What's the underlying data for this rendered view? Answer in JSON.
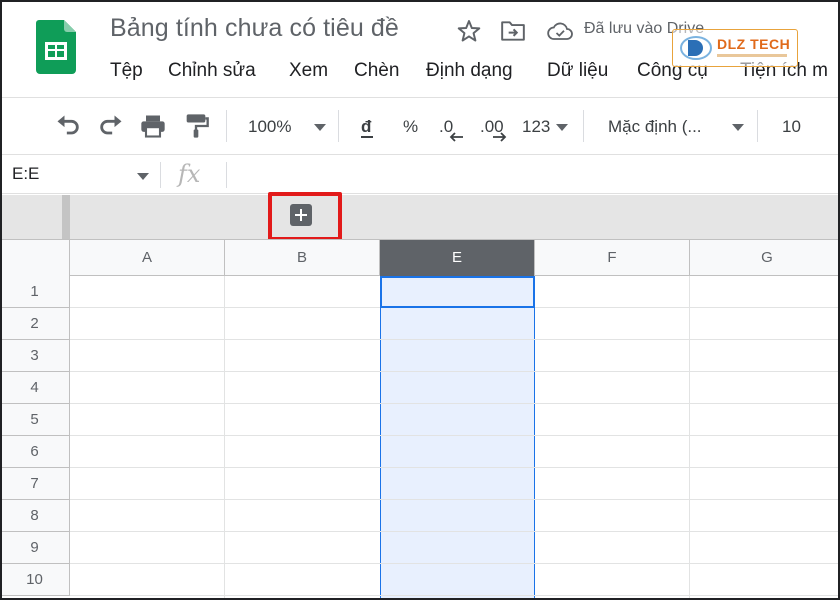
{
  "header": {
    "title": "Bảng tính chưa có tiêu đề",
    "save_status": "Đã lưu vào Drive",
    "watermark": "DLZ TECH"
  },
  "menu": [
    "Tệp",
    "Chỉnh sửa",
    "Xem",
    "Chèn",
    "Định dạng",
    "Dữ liệu",
    "Công cụ",
    "Tiện ích m"
  ],
  "toolbar": {
    "zoom": "100%",
    "currency": "đ",
    "percent": "%",
    "decrease_decimal": ".0",
    "increase_decimal": ".00",
    "more_formats": "123",
    "font": "Mặc định (...",
    "font_size": "10"
  },
  "formula_bar": {
    "name_box": "E:E",
    "fx": "fx"
  },
  "grid": {
    "columns": [
      "A",
      "B",
      "E",
      "F",
      "G"
    ],
    "selected_column": "E",
    "rows": [
      "1",
      "2",
      "3",
      "4",
      "5",
      "6",
      "7",
      "8",
      "9",
      "10"
    ]
  },
  "colors": {
    "sheets_green": "#0f9d58",
    "selection_blue": "#1a73e8",
    "selection_fill": "#e8f0fe",
    "highlight_red": "#e21a1a"
  }
}
